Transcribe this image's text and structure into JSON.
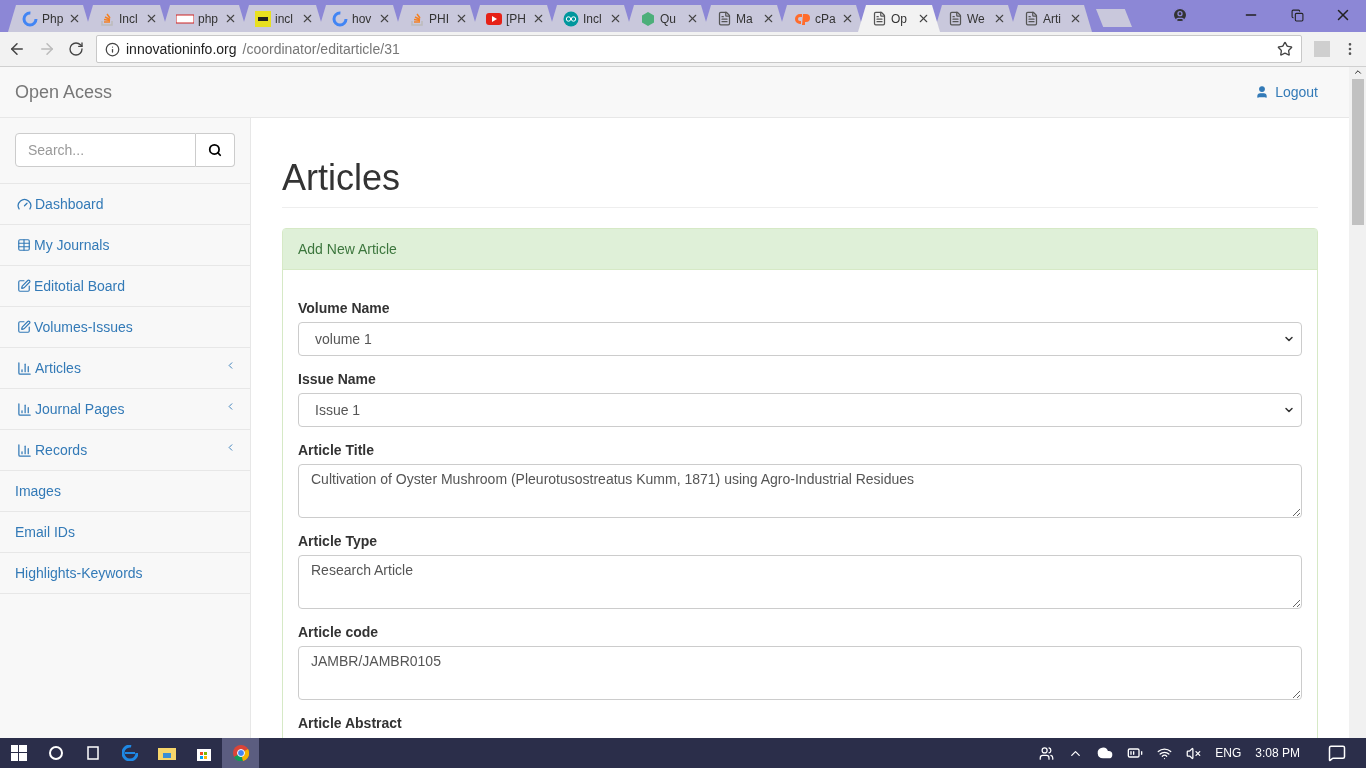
{
  "browser": {
    "tabs": [
      {
        "label": "Php",
        "kind": "google",
        "selected": false
      },
      {
        "label": "Incl",
        "kind": "stack",
        "selected": false
      },
      {
        "label": "php",
        "kind": "wdg",
        "selected": false
      },
      {
        "label": "incl",
        "kind": "wd",
        "selected": false
      },
      {
        "label": "hov",
        "kind": "google",
        "selected": false
      },
      {
        "label": "PHI",
        "kind": "stack",
        "selected": false
      },
      {
        "label": "[PH",
        "kind": "video",
        "selected": false
      },
      {
        "label": "Incl",
        "kind": "infinity",
        "selected": false
      },
      {
        "label": "Qu",
        "kind": "hex",
        "selected": false
      },
      {
        "label": "Ma",
        "kind": "page",
        "selected": false
      },
      {
        "label": "cPa",
        "kind": "cp",
        "selected": false
      },
      {
        "label": "Op",
        "kind": "page",
        "selected": true
      },
      {
        "label": "We",
        "kind": "page",
        "selected": false
      },
      {
        "label": "Arti",
        "kind": "page",
        "selected": false
      }
    ],
    "url_host": "innovationinfo.org",
    "url_path": "/coordinator/editarticle/31"
  },
  "navbar": {
    "brand": "Open Acess",
    "logout": "Logout"
  },
  "sidebar": {
    "search_placeholder": "Search...",
    "items": [
      {
        "label": "Dashboard",
        "kind": "gauge",
        "submenu": false
      },
      {
        "label": "My Journals",
        "kind": "table",
        "submenu": false
      },
      {
        "label": "Editotial Board",
        "kind": "edit",
        "submenu": false
      },
      {
        "label": "Volumes-Issues",
        "kind": "edit",
        "submenu": false
      },
      {
        "label": "Articles",
        "kind": "chart",
        "submenu": true
      },
      {
        "label": "Journal Pages",
        "kind": "chart",
        "submenu": true
      },
      {
        "label": "Records",
        "kind": "chart",
        "submenu": true
      },
      {
        "label": "Images",
        "kind": "none",
        "submenu": false
      },
      {
        "label": "Email IDs",
        "kind": "none",
        "submenu": false
      },
      {
        "label": "Highlights-Keywords",
        "kind": "none",
        "submenu": false
      }
    ]
  },
  "main": {
    "title": "Articles",
    "panel_title": "Add New Article",
    "fields": [
      {
        "label": "Volume Name",
        "kind": "select",
        "value": "volume 1"
      },
      {
        "label": "Issue Name",
        "kind": "select",
        "value": "Issue 1"
      },
      {
        "label": "Article Title",
        "kind": "textarea",
        "value": "Cultivation of Oyster Mushroom (Pleurotusostreatus Kumm, 1871) using Agro-Industrial Residues"
      },
      {
        "label": "Article Type",
        "kind": "textarea",
        "value": "Research Article"
      },
      {
        "label": "Article code",
        "kind": "textarea",
        "value": "JAMBR/JAMBR0105"
      },
      {
        "label": "Article Abstract",
        "kind": "label"
      }
    ]
  },
  "taskbar": {
    "language": "ENG",
    "time": "3:08 PM"
  }
}
